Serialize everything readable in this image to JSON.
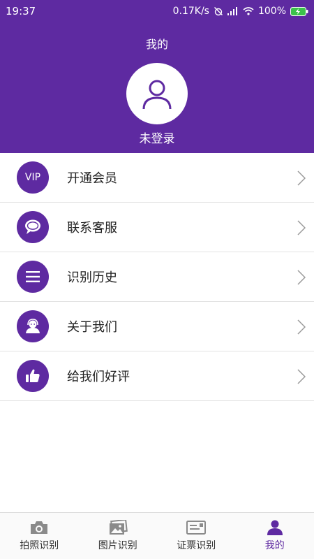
{
  "status_bar": {
    "time": "19:37",
    "network_speed": "0.17K/s",
    "battery": "100%"
  },
  "header": {
    "title": "我的",
    "login_state": "未登录"
  },
  "menu": {
    "items": [
      {
        "label": "开通会员",
        "icon": "vip-icon",
        "icon_text": "VIP"
      },
      {
        "label": "联系客服",
        "icon": "chat-bubble-icon"
      },
      {
        "label": "识别历史",
        "icon": "list-icon"
      },
      {
        "label": "关于我们",
        "icon": "support-agent-icon"
      },
      {
        "label": "给我们好评",
        "icon": "thumbs-up-icon"
      }
    ]
  },
  "tabbar": {
    "tabs": [
      {
        "label": "拍照识别",
        "icon": "camera-icon"
      },
      {
        "label": "图片识别",
        "icon": "image-icon"
      },
      {
        "label": "证票识别",
        "icon": "id-card-icon"
      },
      {
        "label": "我的",
        "icon": "person-icon",
        "active": true
      }
    ]
  },
  "colors": {
    "accent": "#5e2aa1",
    "icon_gray": "#8a8a8a"
  }
}
